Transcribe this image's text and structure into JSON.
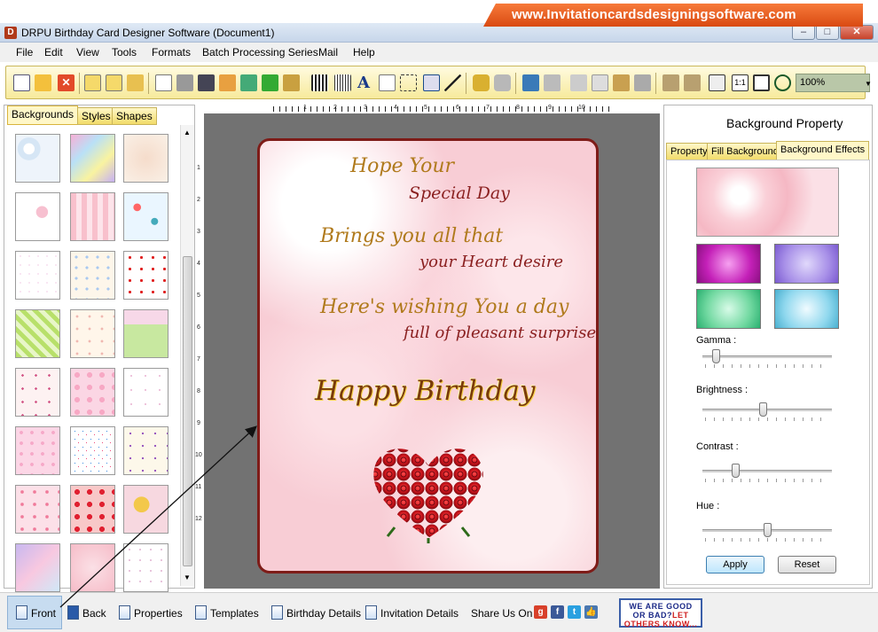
{
  "banner": {
    "text": "www.Invitationcardsdesigningsoftware.com"
  },
  "window": {
    "title": "DRPU Birthday Card Designer Software (Document1)",
    "icon_letter": "D"
  },
  "menu": [
    "File",
    "Edit",
    "View",
    "Tools",
    "Formats",
    "Batch Processing Series",
    "Mail",
    "Help"
  ],
  "toolbar": {
    "zoom": "100%"
  },
  "left_panel": {
    "tabs": [
      "Backgrounds",
      "Styles",
      "Shapes"
    ],
    "active_tab": "Backgrounds"
  },
  "rulers": {
    "h_ticks": [
      "1",
      "2",
      "3",
      "4",
      "5",
      "6",
      "7",
      "8",
      "9",
      "10"
    ],
    "v_ticks": [
      "1",
      "2",
      "3",
      "4",
      "5",
      "6",
      "7",
      "8",
      "9",
      "10",
      "11",
      "12"
    ]
  },
  "card": {
    "line1": "Hope Your",
    "line2": "Special Day",
    "line3": "Brings you all that",
    "line4": "your Heart desire",
    "line5": "Here's wishing You a day",
    "line6": "full of pleasant surprises",
    "headline": "Happy Birthday"
  },
  "right_panel": {
    "title": "Background Property",
    "tabs": [
      "Property",
      "Fill Background",
      "Background Effects"
    ],
    "active_tab": "Background Effects",
    "sliders": [
      {
        "label": "Gamma :",
        "value": 0.08
      },
      {
        "label": "Brightness :",
        "value": 0.47
      },
      {
        "label": "Contrast :",
        "value": 0.24
      },
      {
        "label": "Hue :",
        "value": 0.5
      }
    ],
    "apply_label": "Apply",
    "reset_label": "Reset"
  },
  "bottom": {
    "front": "Front",
    "back": "Back",
    "properties": "Properties",
    "templates": "Templates",
    "birthday_details": "Birthday Details",
    "invitation_details": "Invitation Details",
    "share_label": "Share Us On :",
    "promo_line1": "WE ARE GOOD",
    "promo_line2a": "OR BAD?",
    "promo_line2b": "LET",
    "promo_line3": "OTHERS KNOW..."
  },
  "colors": {
    "accent": "#f2dc6a",
    "card_border": "#7e1c18",
    "banner": "#e0561c"
  }
}
